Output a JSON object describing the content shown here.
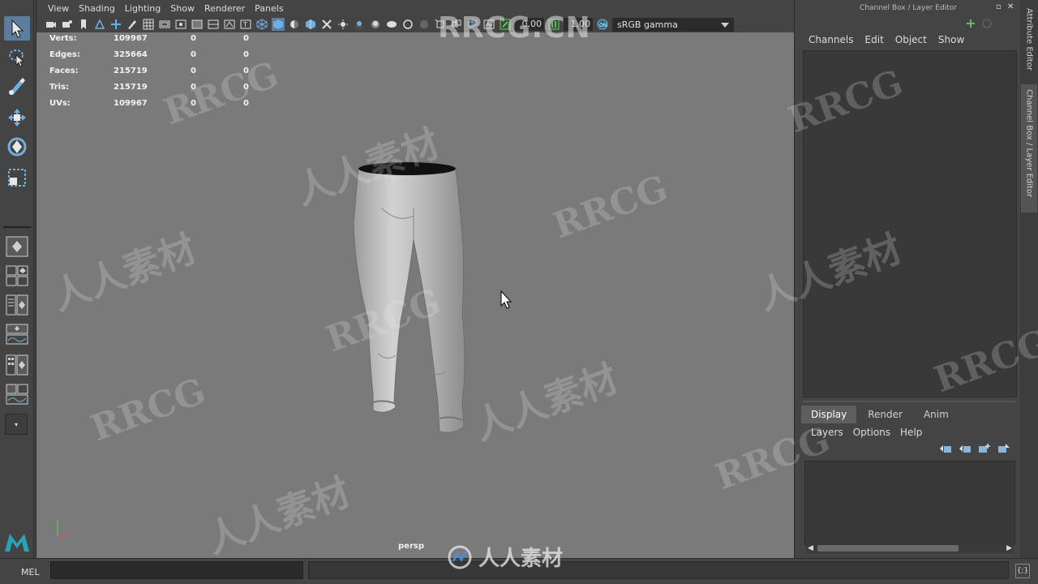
{
  "viewport": {
    "menu": [
      "View",
      "Shading",
      "Lighting",
      "Show",
      "Renderer",
      "Panels"
    ],
    "exposure_value": "0.00",
    "gamma_value": "1.00",
    "color_space": "sRGB gamma",
    "camera": "persp",
    "hud": [
      {
        "label": "Verts:",
        "v1": "109967",
        "v2": "0",
        "v3": "0"
      },
      {
        "label": "Edges:",
        "v1": "325664",
        "v2": "0",
        "v3": "0"
      },
      {
        "label": "Faces:",
        "v1": "215719",
        "v2": "0",
        "v3": "0"
      },
      {
        "label": "Tris:",
        "v1": "215719",
        "v2": "0",
        "v3": "0"
      },
      {
        "label": "UVs:",
        "v1": "109967",
        "v2": "0",
        "v3": "0"
      }
    ]
  },
  "right_panel": {
    "title": "Channel Box / Layer Editor",
    "menu": [
      "Channels",
      "Edit",
      "Object",
      "Show"
    ],
    "tabs": [
      "Display",
      "Render",
      "Anim"
    ],
    "layer_menu": [
      "Layers",
      "Options",
      "Help"
    ]
  },
  "side_tabs": [
    "Attribute Editor",
    "Channel Box / Layer Editor"
  ],
  "command_line": {
    "label": "MEL"
  },
  "watermarks": {
    "site": "RRCG.CN",
    "brand": "RRCG",
    "cjk": "人人素材"
  },
  "colors": {
    "accent": "#5c7e9c",
    "viewport_bg": "#7a7a7a",
    "panel_bg": "#444444"
  }
}
